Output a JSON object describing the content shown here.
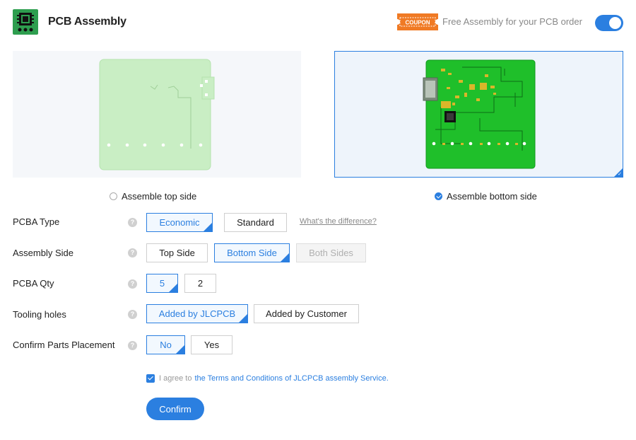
{
  "header": {
    "title": "PCB Assembly",
    "coupon_badge": "COUPON",
    "coupon_text": "Free Assembly for your PCB order",
    "toggle_on": true
  },
  "sides": {
    "top_label": "Assemble top side",
    "bottom_label": "Assemble bottom side",
    "selected": "bottom"
  },
  "form": {
    "pcba_type": {
      "label": "PCBA Type",
      "options": [
        "Economic",
        "Standard"
      ],
      "selected": "Economic",
      "link": "What's the difference?"
    },
    "assembly_side": {
      "label": "Assembly Side",
      "options": [
        "Top Side",
        "Bottom Side",
        "Both Sides"
      ],
      "selected": "Bottom Side",
      "disabled": [
        "Both Sides"
      ]
    },
    "pcba_qty": {
      "label": "PCBA Qty",
      "options": [
        "5",
        "2"
      ],
      "selected": "5"
    },
    "tooling_holes": {
      "label": "Tooling holes",
      "options": [
        "Added by JLCPCB",
        "Added by Customer"
      ],
      "selected": "Added by JLCPCB"
    },
    "confirm_parts": {
      "label": "Confirm Parts Placement",
      "options": [
        "No",
        "Yes"
      ],
      "selected": "No"
    }
  },
  "agreement": {
    "prefix": "I agree to",
    "link": "the Terms and Conditions of JLCPCB assembly Service.",
    "checked": true
  },
  "confirm_label": "Confirm",
  "colors": {
    "accent": "#2b7fe0",
    "pcb_green": "#1fbf2a",
    "pcb_light": "#c9eec4",
    "coupon_orange": "#f07a24"
  },
  "icons": {
    "logo": "chip-logo-icon",
    "help": "question-circle-icon"
  }
}
